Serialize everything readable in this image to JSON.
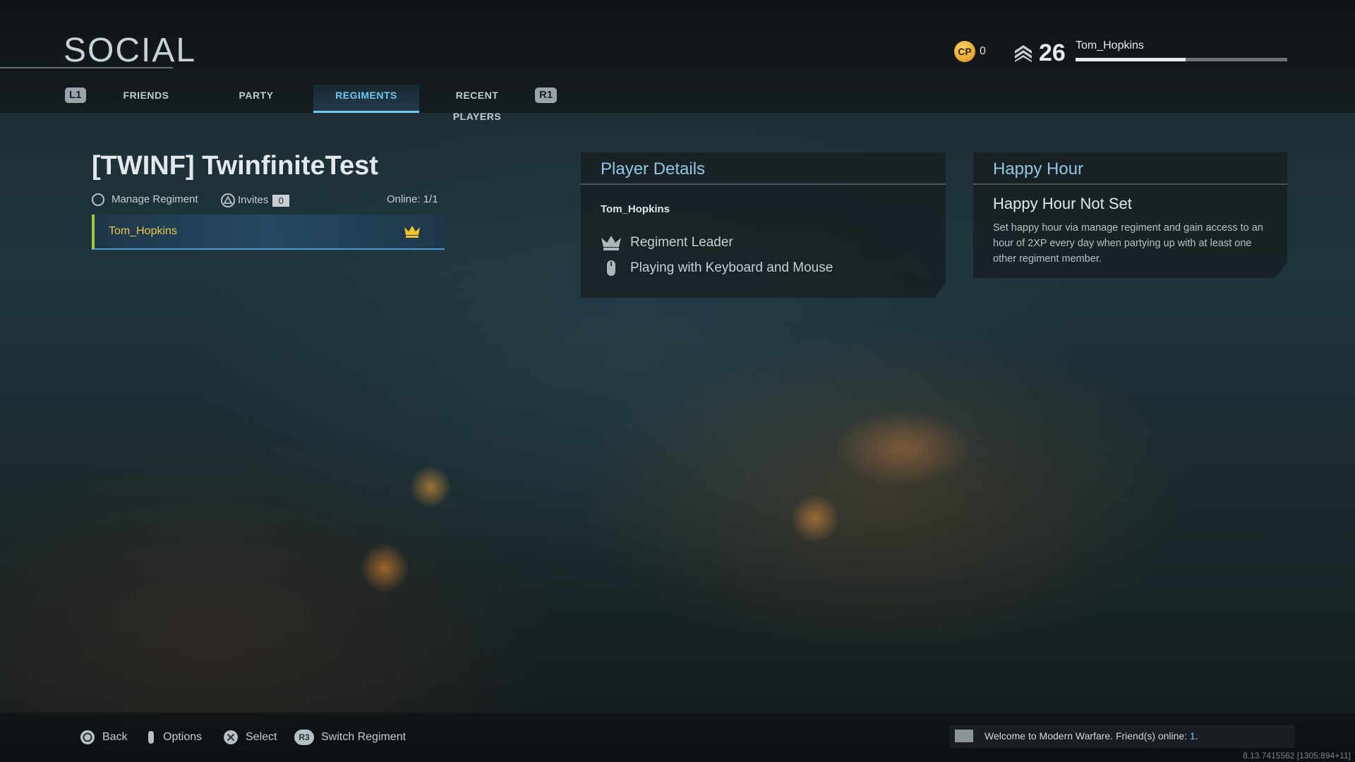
{
  "header": {
    "title": "SOCIAL",
    "left_bumper": "L1",
    "right_bumper": "R1",
    "tabs": [
      {
        "label": "FRIENDS"
      },
      {
        "label": "PARTY"
      },
      {
        "label": "REGIMENTS",
        "active": true
      },
      {
        "label": "RECENT PLAYERS"
      }
    ],
    "cp_icon_text": "CP",
    "cp_value": "0",
    "rank": "26",
    "username": "Tom_Hopkins",
    "xp_progress": 0.52
  },
  "regiment": {
    "name": "[TWINF] TwinfiniteTest",
    "manage_label": "Manage Regiment",
    "invites_label": "Invites",
    "invites_count": "0",
    "online": "Online: 1/1",
    "members": [
      {
        "name": "Tom_Hopkins",
        "leader": true
      }
    ]
  },
  "player_details": {
    "heading": "Player Details",
    "name": "Tom_Hopkins",
    "role": "Regiment Leader",
    "input": "Playing with Keyboard and Mouse"
  },
  "happy_hour": {
    "heading": "Happy Hour",
    "title": "Happy Hour Not Set",
    "description": "Set happy hour via manage regiment and gain access to an hour of 2XP every day when partying up with at least one other regiment member."
  },
  "footer": {
    "prompts": [
      {
        "icon": "circle-button-icon",
        "label": "Back"
      },
      {
        "icon": "options-button-icon",
        "label": "Options"
      },
      {
        "icon": "cross-button-icon",
        "label": "Select"
      },
      {
        "icon": "r3-button-icon",
        "label": "Switch Regiment"
      }
    ],
    "r3_text": "R3",
    "ticker_text": "Welcome to Modern Warfare. Friend(s) online: ",
    "ticker_count": "1",
    "ticker_end": ".",
    "version": "8.13.7415562 [1305:894+11]"
  },
  "colors": {
    "accent": "#6ec7f0",
    "member_highlight": "#e8c74a",
    "crown": "#f2c12e",
    "online_bar": "#9ccc3b"
  }
}
